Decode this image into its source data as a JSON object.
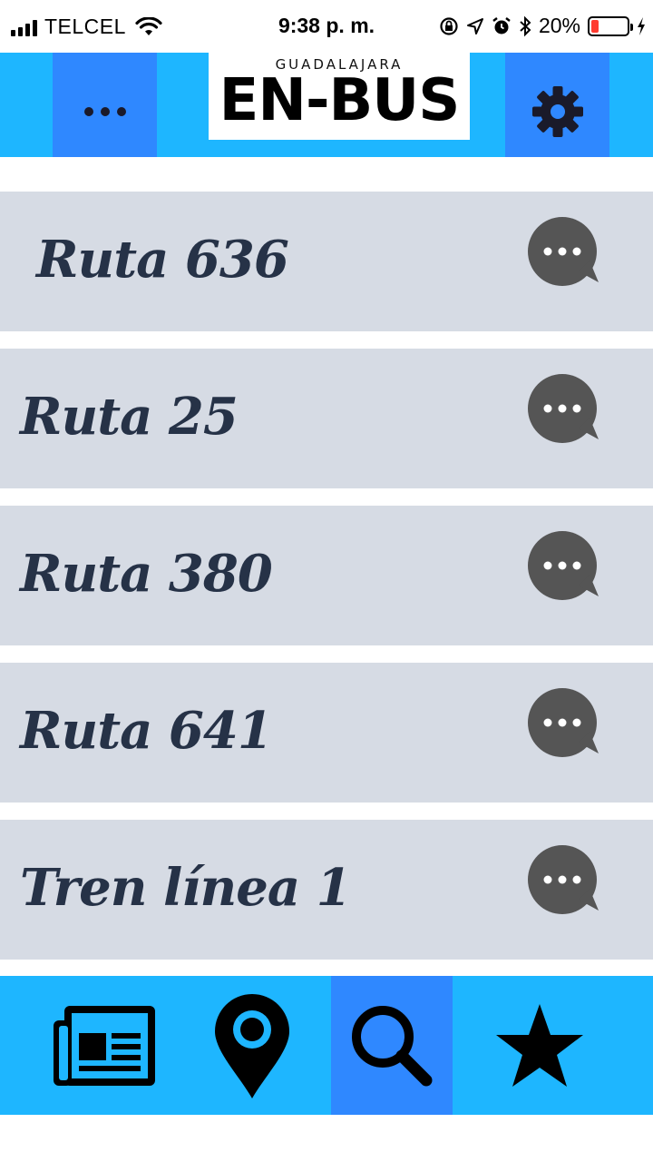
{
  "status_bar": {
    "carrier": "TELCEL",
    "time": "9:38 p. m.",
    "battery_percent": "20%",
    "battery_level": 0.2,
    "icons": [
      "signal-icon",
      "wifi-icon",
      "rotation-lock-icon",
      "location-icon",
      "alarm-icon",
      "bluetooth-icon",
      "battery-icon",
      "charging-icon"
    ]
  },
  "header": {
    "logo_subtitle": "GUADALAJARA",
    "logo_title": "EN-BUS",
    "menu_icon": "more-dots-icon",
    "settings_icon": "gear-icon"
  },
  "routes": [
    {
      "label": "Ruta 636",
      "action_icon": "chat-bubble-icon"
    },
    {
      "label": "Ruta 25",
      "action_icon": "chat-bubble-icon"
    },
    {
      "label": "Ruta 380",
      "action_icon": "chat-bubble-icon"
    },
    {
      "label": "Ruta 641",
      "action_icon": "chat-bubble-icon"
    },
    {
      "label": "Tren línea 1",
      "action_icon": "chat-bubble-icon"
    }
  ],
  "bottom_nav": {
    "items": [
      {
        "icon": "newspaper-icon",
        "active": false
      },
      {
        "icon": "location-pin-icon",
        "active": false
      },
      {
        "icon": "search-icon",
        "active": true
      },
      {
        "icon": "star-icon",
        "active": false
      }
    ]
  },
  "colors": {
    "header_bg": "#1eb6ff",
    "header_button_bg": "#2f88ff",
    "route_bg": "#d6dbe4",
    "route_text": "#263247",
    "chat_icon": "#555555"
  }
}
